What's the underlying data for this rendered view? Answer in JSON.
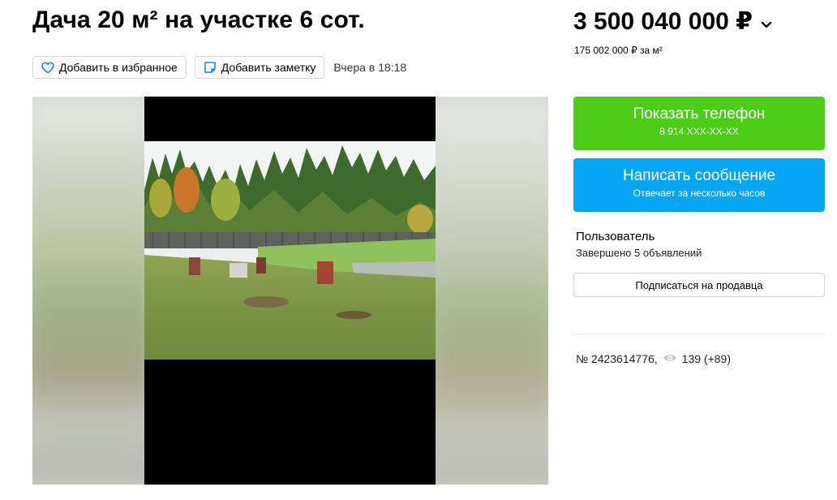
{
  "listing": {
    "title": "Дача 20 м² на участке 6 сот.",
    "favorite_label": "Добавить в избранное",
    "note_label": "Добавить заметку",
    "timestamp": "Вчера в 18:18",
    "price": "3 500 040 000 ₽",
    "price_per_sqm": "175 002 000 ₽ за м²",
    "number": "№ 2423614776,",
    "views": "139 (+89)"
  },
  "contact": {
    "show_phone_label": "Показать телефон",
    "phone_masked": "8 914 XXX-XX-XX",
    "message_label": "Написать сообщение",
    "message_sub": "Отвечает за несколько часов"
  },
  "seller": {
    "name": "Пользователь",
    "meta": "Завершено 5 объявлений",
    "subscribe_label": "Подписаться на продавца"
  },
  "icons": {
    "favorite": "heart-icon",
    "note": "note-icon",
    "price_dropdown": "chevron-down-icon",
    "views": "eye-icon"
  },
  "colors": {
    "phone_button": "#4dcc18",
    "message_button": "#06a6f5",
    "icon_accent": "#0a8ee0"
  }
}
